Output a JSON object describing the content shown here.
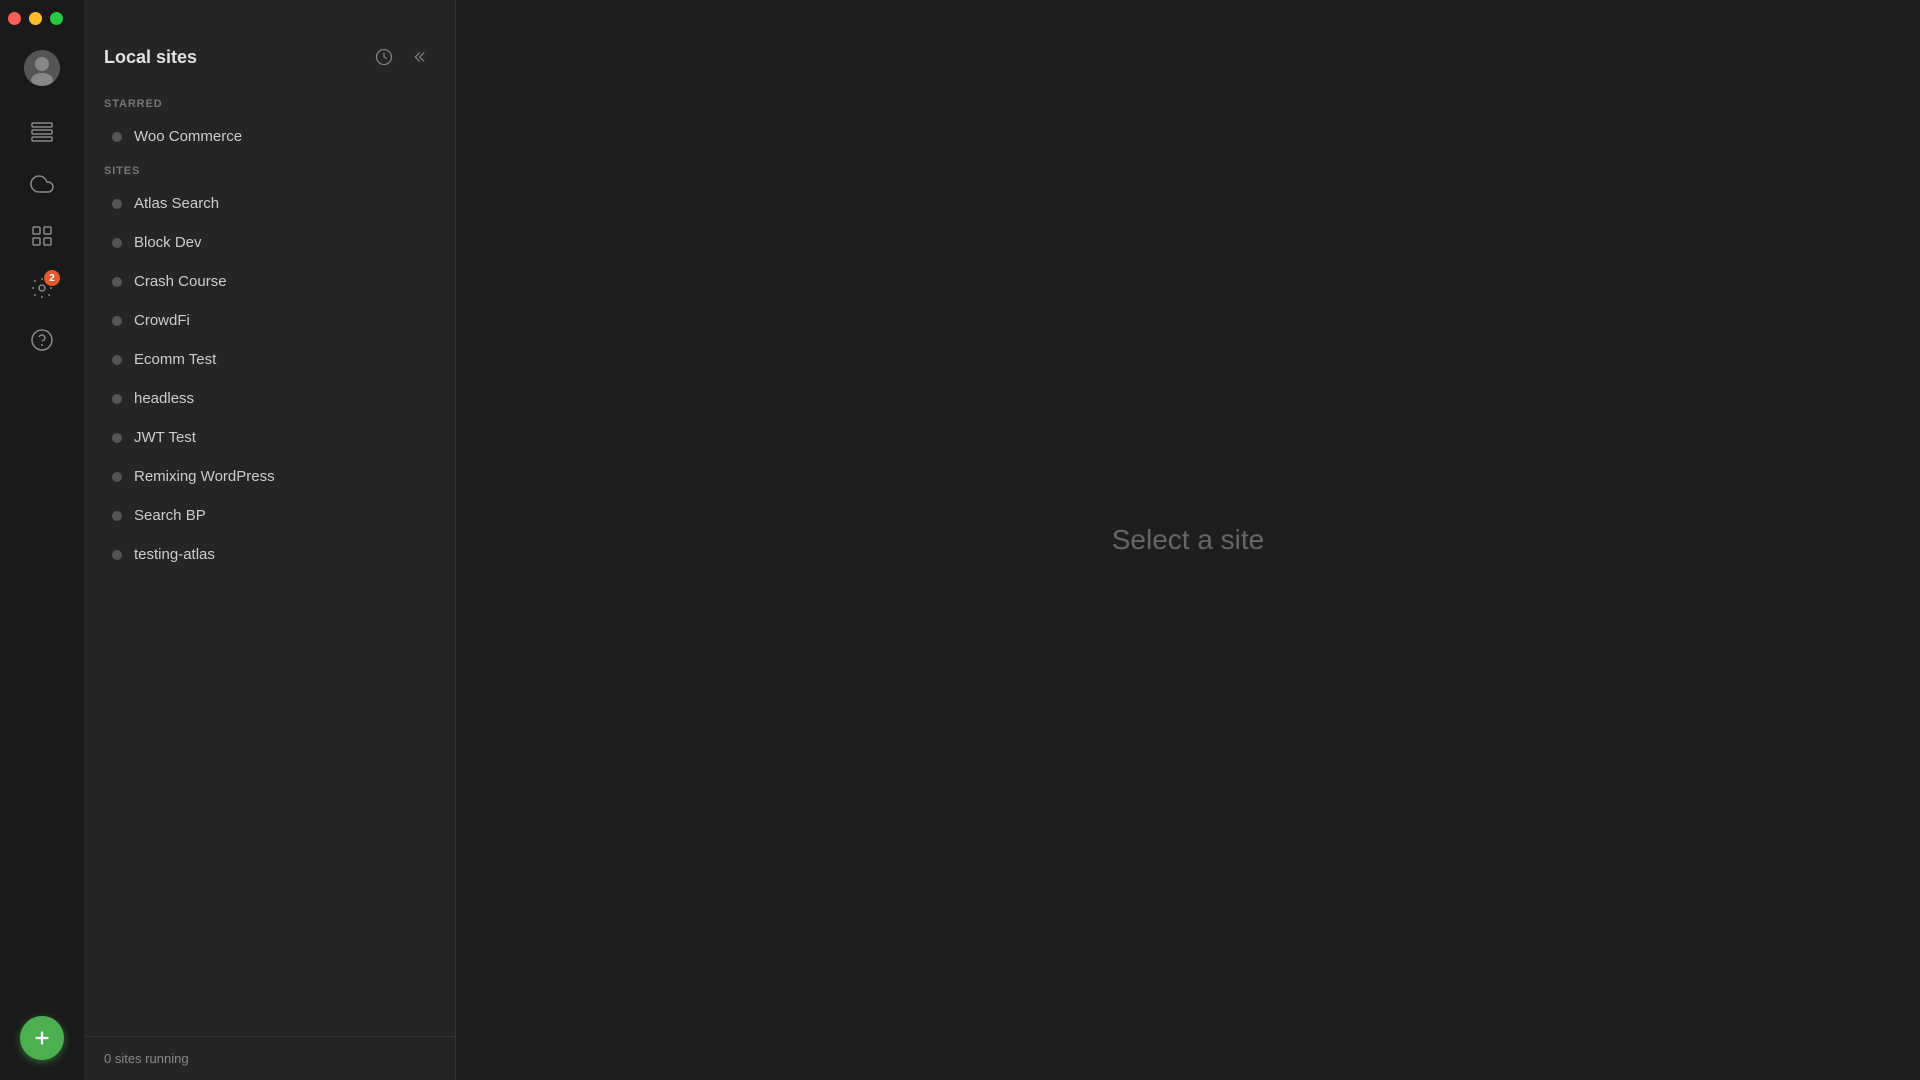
{
  "window": {
    "controls": {
      "close_label": "",
      "minimize_label": "",
      "maximize_label": ""
    }
  },
  "sidebar": {
    "icons": [
      {
        "name": "avatar-icon",
        "label": "User Avatar"
      },
      {
        "name": "layers-icon",
        "label": "Sites"
      },
      {
        "name": "cloud-icon",
        "label": "Cloud"
      },
      {
        "name": "grid-icon",
        "label": "Blueprints"
      },
      {
        "name": "settings-icon",
        "label": "Settings",
        "badge": "2"
      },
      {
        "name": "help-icon",
        "label": "Help"
      }
    ],
    "add_button_label": "+"
  },
  "sites_panel": {
    "title": "Local sites",
    "history_icon": "history",
    "collapse_icon": "collapse",
    "starred_label": "Starred",
    "starred_sites": [
      {
        "name": "Woo Commerce",
        "running": false
      }
    ],
    "sites_label": "Sites",
    "sites": [
      {
        "name": "Atlas Search",
        "running": false
      },
      {
        "name": "Block Dev",
        "running": false
      },
      {
        "name": "Crash Course",
        "running": false
      },
      {
        "name": "CrowdFi",
        "running": false
      },
      {
        "name": "Ecomm Test",
        "running": false
      },
      {
        "name": "headless",
        "running": false
      },
      {
        "name": "JWT Test",
        "running": false
      },
      {
        "name": "Remixing WordPress",
        "running": false
      },
      {
        "name": "Search BP",
        "running": false
      },
      {
        "name": "testing-atlas",
        "running": false
      }
    ],
    "footer": {
      "sites_running_count": "0",
      "sites_running_label": "sites running"
    }
  },
  "main": {
    "placeholder_text": "Select a site"
  }
}
